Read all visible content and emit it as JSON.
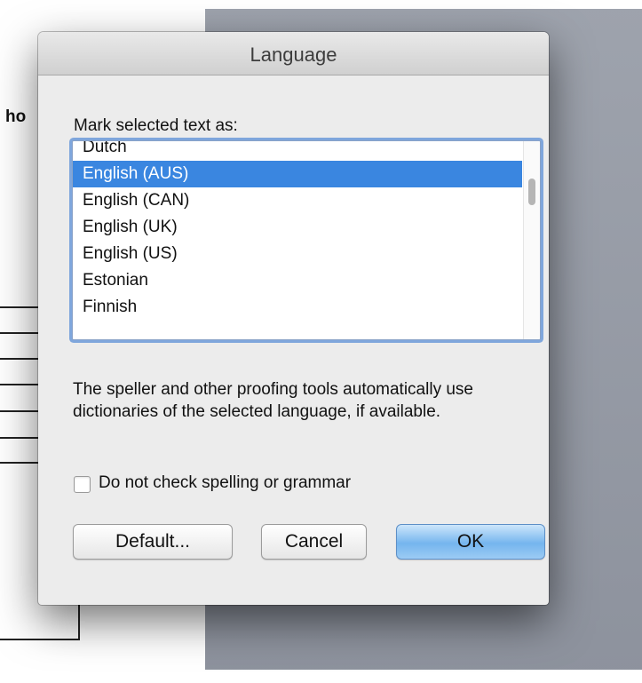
{
  "background_document": {
    "visible_text": "ho"
  },
  "dialog": {
    "title": "Language",
    "prompt_label": "Mark selected text as:",
    "language_list": {
      "items": [
        "Dutch",
        "English (AUS)",
        "English (CAN)",
        "English (UK)",
        "English (US)",
        "Estonian",
        "Finnish"
      ],
      "selected": "English (AUS)"
    },
    "info_text": "The speller and other proofing tools automatically use dictionaries of the selected language, if available.",
    "checkbox": {
      "label": "Do not check spelling or grammar",
      "checked": false
    },
    "buttons": {
      "default": "Default...",
      "cancel": "Cancel",
      "ok": "OK"
    }
  },
  "colors": {
    "selection": "#3a86e0",
    "focus_ring": "#7fa6dc",
    "ok_button": "#75b5ee"
  }
}
